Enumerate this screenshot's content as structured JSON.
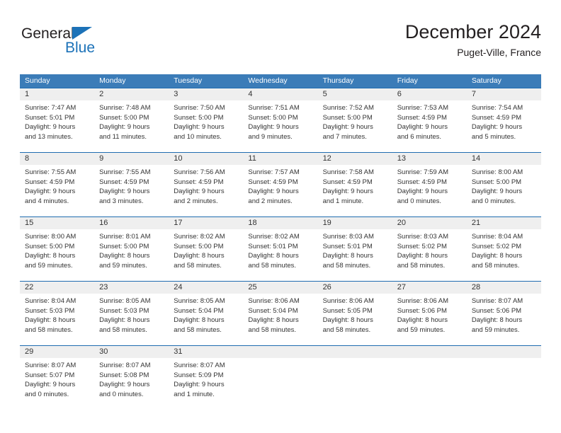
{
  "logo": {
    "word1": "General",
    "word2": "Blue",
    "accent_color": "#1c72b8"
  },
  "header": {
    "title": "December 2024",
    "location": "Puget-Ville, France"
  },
  "calendar": {
    "header_color": "#3b7cb8",
    "daynum_strip_color": "#efefef",
    "weekdays": [
      "Sunday",
      "Monday",
      "Tuesday",
      "Wednesday",
      "Thursday",
      "Friday",
      "Saturday"
    ],
    "weeks": [
      [
        {
          "day": "1",
          "sunrise": "Sunrise: 7:47 AM",
          "sunset": "Sunset: 5:01 PM",
          "daylight1": "Daylight: 9 hours",
          "daylight2": "and 13 minutes."
        },
        {
          "day": "2",
          "sunrise": "Sunrise: 7:48 AM",
          "sunset": "Sunset: 5:00 PM",
          "daylight1": "Daylight: 9 hours",
          "daylight2": "and 11 minutes."
        },
        {
          "day": "3",
          "sunrise": "Sunrise: 7:50 AM",
          "sunset": "Sunset: 5:00 PM",
          "daylight1": "Daylight: 9 hours",
          "daylight2": "and 10 minutes."
        },
        {
          "day": "4",
          "sunrise": "Sunrise: 7:51 AM",
          "sunset": "Sunset: 5:00 PM",
          "daylight1": "Daylight: 9 hours",
          "daylight2": "and 9 minutes."
        },
        {
          "day": "5",
          "sunrise": "Sunrise: 7:52 AM",
          "sunset": "Sunset: 5:00 PM",
          "daylight1": "Daylight: 9 hours",
          "daylight2": "and 7 minutes."
        },
        {
          "day": "6",
          "sunrise": "Sunrise: 7:53 AM",
          "sunset": "Sunset: 4:59 PM",
          "daylight1": "Daylight: 9 hours",
          "daylight2": "and 6 minutes."
        },
        {
          "day": "7",
          "sunrise": "Sunrise: 7:54 AM",
          "sunset": "Sunset: 4:59 PM",
          "daylight1": "Daylight: 9 hours",
          "daylight2": "and 5 minutes."
        }
      ],
      [
        {
          "day": "8",
          "sunrise": "Sunrise: 7:55 AM",
          "sunset": "Sunset: 4:59 PM",
          "daylight1": "Daylight: 9 hours",
          "daylight2": "and 4 minutes."
        },
        {
          "day": "9",
          "sunrise": "Sunrise: 7:55 AM",
          "sunset": "Sunset: 4:59 PM",
          "daylight1": "Daylight: 9 hours",
          "daylight2": "and 3 minutes."
        },
        {
          "day": "10",
          "sunrise": "Sunrise: 7:56 AM",
          "sunset": "Sunset: 4:59 PM",
          "daylight1": "Daylight: 9 hours",
          "daylight2": "and 2 minutes."
        },
        {
          "day": "11",
          "sunrise": "Sunrise: 7:57 AM",
          "sunset": "Sunset: 4:59 PM",
          "daylight1": "Daylight: 9 hours",
          "daylight2": "and 2 minutes."
        },
        {
          "day": "12",
          "sunrise": "Sunrise: 7:58 AM",
          "sunset": "Sunset: 4:59 PM",
          "daylight1": "Daylight: 9 hours",
          "daylight2": "and 1 minute."
        },
        {
          "day": "13",
          "sunrise": "Sunrise: 7:59 AM",
          "sunset": "Sunset: 4:59 PM",
          "daylight1": "Daylight: 9 hours",
          "daylight2": "and 0 minutes."
        },
        {
          "day": "14",
          "sunrise": "Sunrise: 8:00 AM",
          "sunset": "Sunset: 5:00 PM",
          "daylight1": "Daylight: 9 hours",
          "daylight2": "and 0 minutes."
        }
      ],
      [
        {
          "day": "15",
          "sunrise": "Sunrise: 8:00 AM",
          "sunset": "Sunset: 5:00 PM",
          "daylight1": "Daylight: 8 hours",
          "daylight2": "and 59 minutes."
        },
        {
          "day": "16",
          "sunrise": "Sunrise: 8:01 AM",
          "sunset": "Sunset: 5:00 PM",
          "daylight1": "Daylight: 8 hours",
          "daylight2": "and 59 minutes."
        },
        {
          "day": "17",
          "sunrise": "Sunrise: 8:02 AM",
          "sunset": "Sunset: 5:00 PM",
          "daylight1": "Daylight: 8 hours",
          "daylight2": "and 58 minutes."
        },
        {
          "day": "18",
          "sunrise": "Sunrise: 8:02 AM",
          "sunset": "Sunset: 5:01 PM",
          "daylight1": "Daylight: 8 hours",
          "daylight2": "and 58 minutes."
        },
        {
          "day": "19",
          "sunrise": "Sunrise: 8:03 AM",
          "sunset": "Sunset: 5:01 PM",
          "daylight1": "Daylight: 8 hours",
          "daylight2": "and 58 minutes."
        },
        {
          "day": "20",
          "sunrise": "Sunrise: 8:03 AM",
          "sunset": "Sunset: 5:02 PM",
          "daylight1": "Daylight: 8 hours",
          "daylight2": "and 58 minutes."
        },
        {
          "day": "21",
          "sunrise": "Sunrise: 8:04 AM",
          "sunset": "Sunset: 5:02 PM",
          "daylight1": "Daylight: 8 hours",
          "daylight2": "and 58 minutes."
        }
      ],
      [
        {
          "day": "22",
          "sunrise": "Sunrise: 8:04 AM",
          "sunset": "Sunset: 5:03 PM",
          "daylight1": "Daylight: 8 hours",
          "daylight2": "and 58 minutes."
        },
        {
          "day": "23",
          "sunrise": "Sunrise: 8:05 AM",
          "sunset": "Sunset: 5:03 PM",
          "daylight1": "Daylight: 8 hours",
          "daylight2": "and 58 minutes."
        },
        {
          "day": "24",
          "sunrise": "Sunrise: 8:05 AM",
          "sunset": "Sunset: 5:04 PM",
          "daylight1": "Daylight: 8 hours",
          "daylight2": "and 58 minutes."
        },
        {
          "day": "25",
          "sunrise": "Sunrise: 8:06 AM",
          "sunset": "Sunset: 5:04 PM",
          "daylight1": "Daylight: 8 hours",
          "daylight2": "and 58 minutes."
        },
        {
          "day": "26",
          "sunrise": "Sunrise: 8:06 AM",
          "sunset": "Sunset: 5:05 PM",
          "daylight1": "Daylight: 8 hours",
          "daylight2": "and 58 minutes."
        },
        {
          "day": "27",
          "sunrise": "Sunrise: 8:06 AM",
          "sunset": "Sunset: 5:06 PM",
          "daylight1": "Daylight: 8 hours",
          "daylight2": "and 59 minutes."
        },
        {
          "day": "28",
          "sunrise": "Sunrise: 8:07 AM",
          "sunset": "Sunset: 5:06 PM",
          "daylight1": "Daylight: 8 hours",
          "daylight2": "and 59 minutes."
        }
      ],
      [
        {
          "day": "29",
          "sunrise": "Sunrise: 8:07 AM",
          "sunset": "Sunset: 5:07 PM",
          "daylight1": "Daylight: 9 hours",
          "daylight2": "and 0 minutes."
        },
        {
          "day": "30",
          "sunrise": "Sunrise: 8:07 AM",
          "sunset": "Sunset: 5:08 PM",
          "daylight1": "Daylight: 9 hours",
          "daylight2": "and 0 minutes."
        },
        {
          "day": "31",
          "sunrise": "Sunrise: 8:07 AM",
          "sunset": "Sunset: 5:09 PM",
          "daylight1": "Daylight: 9 hours",
          "daylight2": "and 1 minute."
        },
        {
          "day": "",
          "sunrise": "",
          "sunset": "",
          "daylight1": "",
          "daylight2": ""
        },
        {
          "day": "",
          "sunrise": "",
          "sunset": "",
          "daylight1": "",
          "daylight2": ""
        },
        {
          "day": "",
          "sunrise": "",
          "sunset": "",
          "daylight1": "",
          "daylight2": ""
        },
        {
          "day": "",
          "sunrise": "",
          "sunset": "",
          "daylight1": "",
          "daylight2": ""
        }
      ]
    ]
  }
}
